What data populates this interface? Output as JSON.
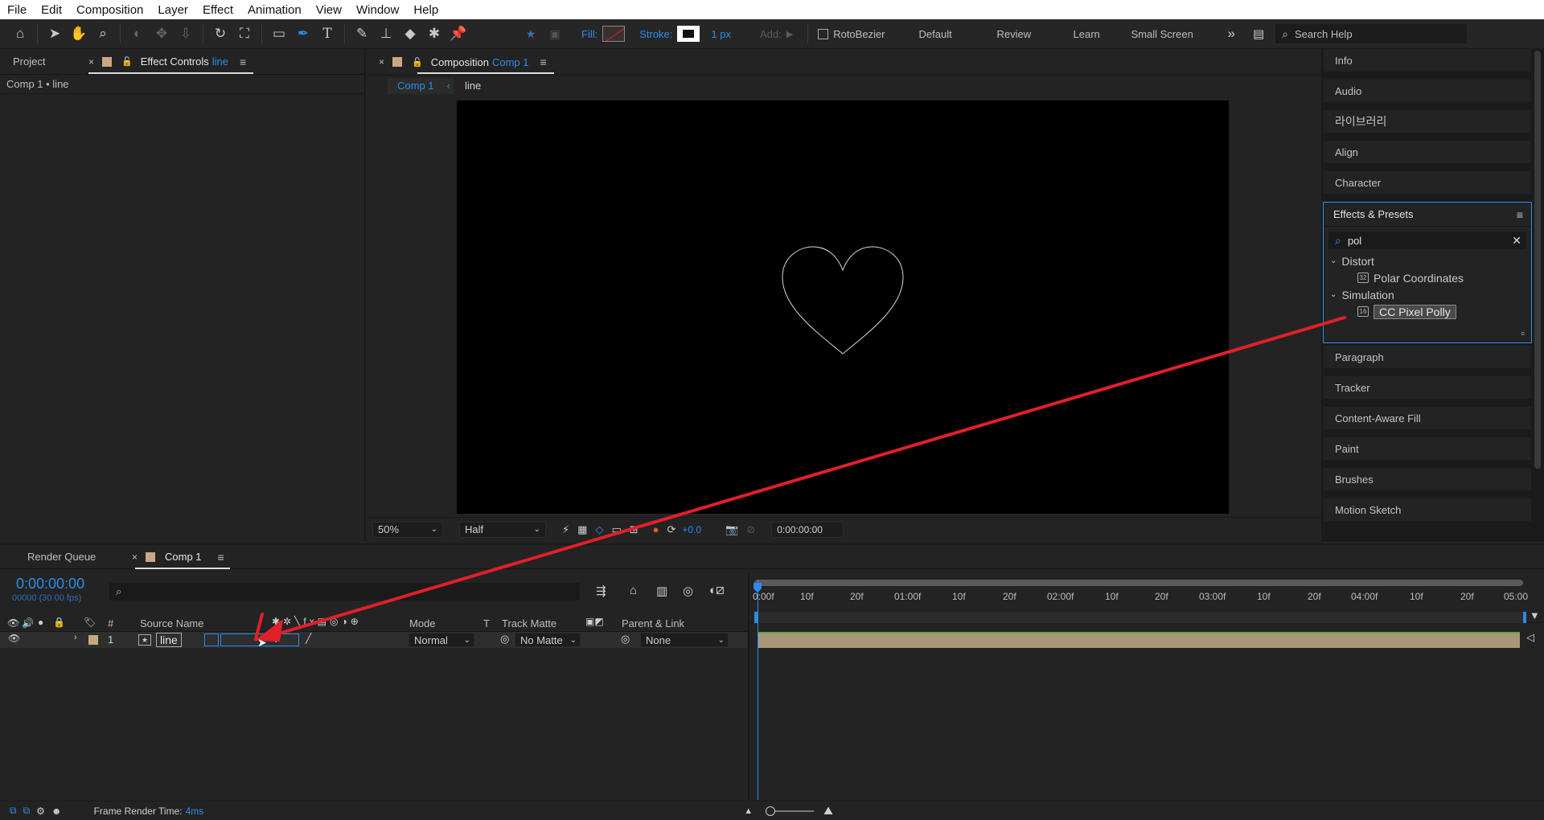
{
  "menu": [
    "File",
    "Edit",
    "Composition",
    "Layer",
    "Effect",
    "Animation",
    "View",
    "Window",
    "Help"
  ],
  "toolbar": {
    "fill_label": "Fill:",
    "stroke_label": "Stroke:",
    "stroke_width": "1 px",
    "add_label": "Add:",
    "rotobezier_label": "RotoBezier",
    "workspaces": [
      "Default",
      "Review",
      "Learn",
      "Small Screen"
    ],
    "search_placeholder": "Search Help",
    "tool_icons": [
      "home-icon",
      "selection-icon",
      "hand-icon",
      "zoom-icon",
      "orbit-icon",
      "pan-behind-icon",
      "track-z-icon",
      "rotate-icon",
      "camera-icon",
      "rectangle-icon",
      "pen-icon",
      "type-icon",
      "brush-icon",
      "clone-stamp-icon",
      "eraser-icon",
      "roto-brush-icon",
      "puppet-pin-icon"
    ]
  },
  "left_panel": {
    "tab_project": "Project",
    "tab_effect_controls": "Effect Controls",
    "effect_controls_layer": "line",
    "breadcrumb": "Comp 1 • line"
  },
  "viewer": {
    "tab_prefix": "Composition",
    "tab_name": "Comp 1",
    "nav_comp": "Comp 1",
    "nav_layer": "line",
    "zoom": "50%",
    "resolution": "Half",
    "exposure": "+0.0",
    "timecode": "0:00:00:00",
    "canvas_bg": "#000000",
    "shape": "heart"
  },
  "right_panel": {
    "items_top": [
      "Info",
      "Audio",
      "라이브러리",
      "Align",
      "Character"
    ],
    "effects_title": "Effects & Presets",
    "search_value": "pol",
    "tree": [
      {
        "category": "Distort",
        "items": [
          "Polar Coordinates"
        ]
      },
      {
        "category": "Simulation",
        "items": [
          "CC Pixel Polly"
        ]
      }
    ],
    "selected_item": "CC Pixel Polly",
    "items_bottom": [
      "Paragraph",
      "Tracker",
      "Content-Aware Fill",
      "Paint",
      "Brushes",
      "Motion Sketch"
    ]
  },
  "timeline": {
    "tab_render_queue": "Render Queue",
    "tab_comp": "Comp 1",
    "timecode": "0:00:00:00",
    "frame_info": "00000 (30.00 fps)",
    "columns": {
      "number": "#",
      "source_name": "Source Name",
      "mode": "Mode",
      "t": "T",
      "track_matte": "Track Matte",
      "parent_link": "Parent & Link"
    },
    "layers": [
      {
        "number": "1",
        "name": "line",
        "mode": "Normal",
        "track_matte": "No Matte",
        "parent": "None"
      }
    ],
    "ruler_labels": [
      "0:00f",
      "10f",
      "20f",
      "01:00f",
      "10f",
      "20f",
      "02:00f",
      "10f",
      "20f",
      "03:00f",
      "10f",
      "20f",
      "04:00f",
      "10f",
      "20f",
      "05:00"
    ],
    "footer_label": "Frame Render Time:",
    "footer_value": "4ms"
  },
  "colors": {
    "accent": "#2d8ceb",
    "arrow": "#e0202a",
    "layer_bar": "#a99679",
    "label_swatch": "#c8a882"
  }
}
